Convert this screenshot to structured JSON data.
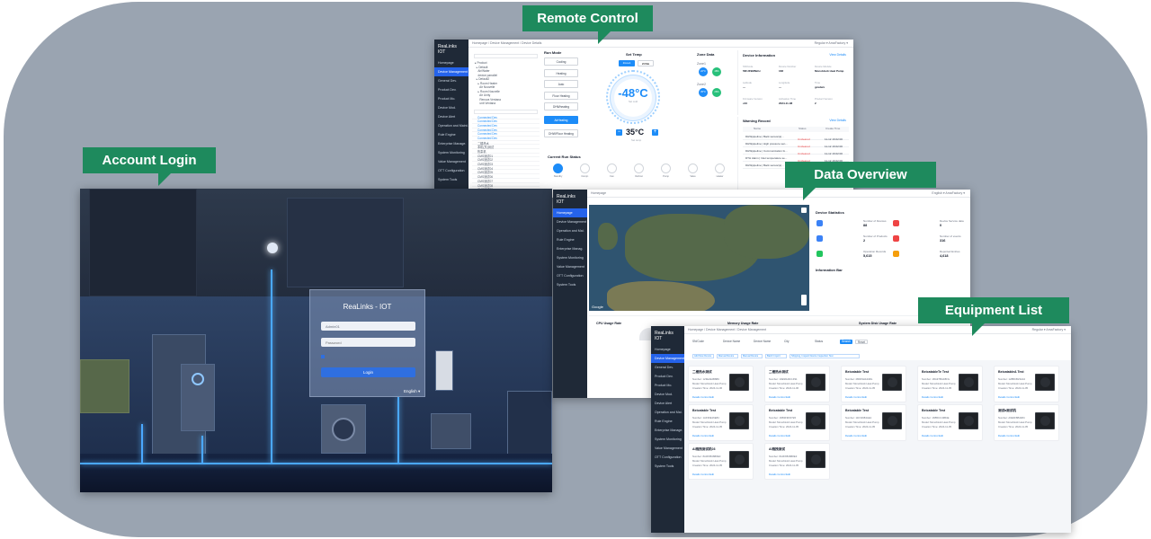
{
  "callouts": {
    "remote_control": "Remote Control",
    "account_login": "Account Login",
    "data_overview": "Data Overview",
    "equipment_list": "Equipment List"
  },
  "login": {
    "title": "ReaLinks - IOT",
    "username_value": "Admin01",
    "password_placeholder": "Password",
    "login_button": "Login",
    "language": "English ▾"
  },
  "remote": {
    "brand": "ReaLinks IOT",
    "breadcrumb": "Homepage / Device Management / Device Details",
    "user": "Regular ▾  AmaFactory ▾",
    "sidebar": [
      "Homepage",
      "Device Management",
      "General Dev.",
      "Product Dev.",
      "Product Mo.",
      "Device Mod.",
      "Device Alert",
      "Operation and Maint.",
      "Rule Engine",
      "Enterprise Manage.",
      "System Monitoring",
      "Value Management",
      "OTT Configuration",
      "System Tools"
    ],
    "tree": [
      "▸ Product",
      "  ▸ Default",
      "    Air/Water",
      "    device parrallel",
      "  ▸ Default2",
      "    ▸ Room Heater",
      "      Air Nouvelle",
      "    ▸ Room Nouvelle",
      "      Air Unity",
      "      Renova Ventana",
      "      unit Ventana"
    ],
    "tree_list": [
      "Connected Dev",
      "Connected Dev",
      "Connected Dev",
      "Connected Dev",
      "Connected Dev",
      "Connected Dev",
      "二楼热水",
      "本机(东)测试",
      "热泵机",
      "CMS测试01",
      "CMS测试02",
      "CMS测试03",
      "CMS测试04",
      "CMS测试05",
      "CMS测试06",
      "CMS测试07",
      "CMS测试08",
      "CMS测试09",
      "CMS测试10",
      "CMS测试11",
      "CMS测试12"
    ],
    "run_mode_title": "Run Mode",
    "run_modes": [
      "Cooling",
      "Heating",
      "Auto",
      "Floor Heating",
      "DHWheating",
      "AirHeating",
      "DHW/Floor Heating"
    ],
    "selected_mode": "AirHeating",
    "set_temp_title": "Set Temp",
    "tabs": [
      "Zone1",
      "ZONE"
    ],
    "set_temp_value": "-48°C",
    "set_temp_caption": "Set cold",
    "target_temp": "35°C",
    "target_caption": "Set temp",
    "zone_title": "Zone Data",
    "zone1": "Zone1",
    "zone2": "Zone2",
    "zone_values": [
      "22°C",
      "48%",
      "35°C",
      "26%"
    ],
    "current_status_title": "Current Run Status",
    "status_labels": [
      "Standby",
      "Compr.",
      "Fan",
      "Defrost",
      "Pump",
      "Valve",
      "Heater"
    ],
    "device_info_title": "Device Information",
    "view_details": "View Details",
    "device_info": [
      {
        "k": "SN/Code",
        "v": "56FJF9M6kCc"
      },
      {
        "k": "Device Number",
        "v": "168"
      },
      {
        "k": "Device Module",
        "v": "Monoblock Heat Pump"
      },
      {
        "k": "Latitude",
        "v": "—"
      },
      {
        "k": "Longitude",
        "v": "—"
      },
      {
        "k": "Time",
        "v": "gxsdwx"
      },
      {
        "k": "Firmware Version",
        "v": "v10"
      },
      {
        "k": "Activation Time",
        "v": "2024-11-08"
      },
      {
        "k": "Product Version",
        "v": "2"
      }
    ],
    "warning_title": "Warning Record",
    "warning_headers": [
      "Name",
      "Status",
      "Create Time"
    ],
    "warnings": [
      {
        "n": "DHWpipeline | Back sensor(a)...",
        "s": "Uncleared",
        "t": "11-12 16:02:00"
      },
      {
        "n": "DHWpipeline | High pressure sen...",
        "s": "Uncleared",
        "t": "11-12 16:02:00"
      },
      {
        "n": "DHWpipeline | Communication fo...",
        "s": "Uncleared",
        "t": "11-12 16:02:00"
      },
      {
        "n": "DTH Alarm | Inlet temperature se...",
        "s": "Uncleared",
        "t": "11-12 16:02:00"
      },
      {
        "n": "DHWpipeline | Back sensor(a)...",
        "s": "Uncleared",
        "t": "11-12 16:02:00"
      }
    ]
  },
  "data": {
    "brand": "ReaLinks IOT",
    "breadcrumb": "Homepage",
    "user": "English ▾  AmaFactory ▾",
    "sidebar": [
      "Homepage",
      "Device Management",
      "Operation and Mai.",
      "Rule Engine",
      "Enterprise Manag.",
      "System Monitoring",
      "Value Management",
      "OTT Configuration",
      "System Tools"
    ],
    "map_brand": "Google",
    "device_stats_title": "Device Statistics",
    "stats": [
      {
        "label": "Number of Devices",
        "value": "88",
        "color": "#3b82f6"
      },
      {
        "label": "Device Service data",
        "value": "0",
        "color": "#ef4444"
      },
      {
        "label": "Number of Products",
        "value": "2",
        "color": "#3b82f6"
      },
      {
        "label": "Number of events",
        "value": "316",
        "color": "#ef4444"
      },
      {
        "label": "Operation Records",
        "value": "5,615",
        "color": "#22c55e"
      },
      {
        "label": "Reported Entries",
        "value": "4,618",
        "color": "#f59e0b"
      }
    ],
    "info_bar_title": "Information Bar",
    "cpu_title": "CPU Usage Rate",
    "mem_title": "Memory Usage Rate",
    "disk_title": "System Disk Usage Rate"
  },
  "equip": {
    "brand": "ReaLinks IOT",
    "breadcrumb": "Homepage / Device Management / Device Management",
    "user": "Regular ▾  AmaFactory ▾",
    "sidebar": [
      "Homepage",
      "Device Management",
      "General Dev.",
      "Product Dev.",
      "Product Mo.",
      "Device Mod.",
      "Device Alert",
      "Operation and Mai.",
      "Rule Engine",
      "Enterprise Manage.",
      "System Monitoring",
      "Value Management",
      "OTT Configuration",
      "System Tools"
    ],
    "filters": [
      "SN/Code",
      "Device Name",
      "Device Name",
      "City",
      "Status"
    ],
    "search": "Search",
    "reset": "Reset",
    "filter_row2": [
      "Add New Device",
      "Manual Device",
      "Manual Device",
      "Batch Import",
      "Shipping, Inspect Device Inspection Test"
    ],
    "cards": [
      {
        "name": "二楼热水测试",
        "number": "Number: 123E2E2B6B9",
        "module": "Model: Monoblock Heat Pump",
        "date": "Creation Time: 2024-11-06"
      },
      {
        "name": "二楼热水测试",
        "number": "Number: 10E99H3C1F91",
        "module": "Model: Monoblock Heat Pump",
        "date": "Creation Time: 2024-11-06"
      },
      {
        "name": "Beicatable Test",
        "number": "Number: 28DF9H4446G",
        "module": "Model: Monoblock Heat Pump",
        "date": "Creation Time: 2024-11-05"
      },
      {
        "name": "BeicatableTe Test",
        "number": "Number: 18G97BGF8FG",
        "module": "Model: Monoblock Heat Pump",
        "date": "Creation Time: 2024-11-05"
      },
      {
        "name": "BeicatableA Test",
        "number": "Number: 128BCB23A42",
        "module": "Model: Monoblock Heat Pump",
        "date": "Creation Time: 2024-11-05"
      },
      {
        "name": "Beicatable Test",
        "number": "Number: 1AF39E16E84",
        "module": "Model: Monoblock Heat Pump",
        "date": "Creation Time: 2024-11-05"
      },
      {
        "name": "Beicatable Test",
        "number": "Number: 16B3F9FD7E5",
        "module": "Model: Monoblock Heat Pump",
        "date": "Creation Time: 2024-11-05"
      },
      {
        "name": "Beicatable Test",
        "number": "Number: 11F19984AE1",
        "module": "Model: Monoblock Heat Pump",
        "date": "Creation Time: 2024-11-05"
      },
      {
        "name": "Beicatable Test",
        "number": "Number: 16B5CC43B4E",
        "module": "Model: Monoblock Heat Pump",
        "date": "Creation Time: 2024-11-05"
      },
      {
        "name": "测试a测试机",
        "number": "Number: A6E3F8B4484",
        "module": "Model: Monoblock Heat Pump",
        "date": "Creation Time: 2024-11-05"
      },
      {
        "name": "AI拖拽测试机03",
        "number": "Number: 8A3F8846B8E0",
        "module": "Model: Monoblock Heat Pump",
        "date": "Creation Time: 2024-11-05"
      },
      {
        "name": "AI拖拽测试",
        "number": "Number: 8A3F8846B8E3",
        "module": "Model: Monoblock Heat Pump",
        "date": "Creation Time: 2024-11-05"
      }
    ],
    "card_actions": "Details   Control   Edit"
  },
  "colors": {
    "callout": "#1e8a5d",
    "backdrop": "#9aa4b1",
    "accent": "#1d8cf8",
    "sidebar": "#1f2937"
  }
}
